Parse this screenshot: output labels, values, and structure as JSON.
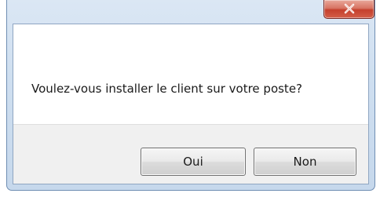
{
  "dialog": {
    "message": "Voulez-vous installer le client sur votre poste?",
    "buttons": {
      "yes_label": "Oui",
      "no_label": "Non"
    },
    "close_icon": "close-icon"
  },
  "colors": {
    "frame": "#cfdff0",
    "close_button": "#c5402d",
    "button_panel": "#f0f0f0"
  }
}
